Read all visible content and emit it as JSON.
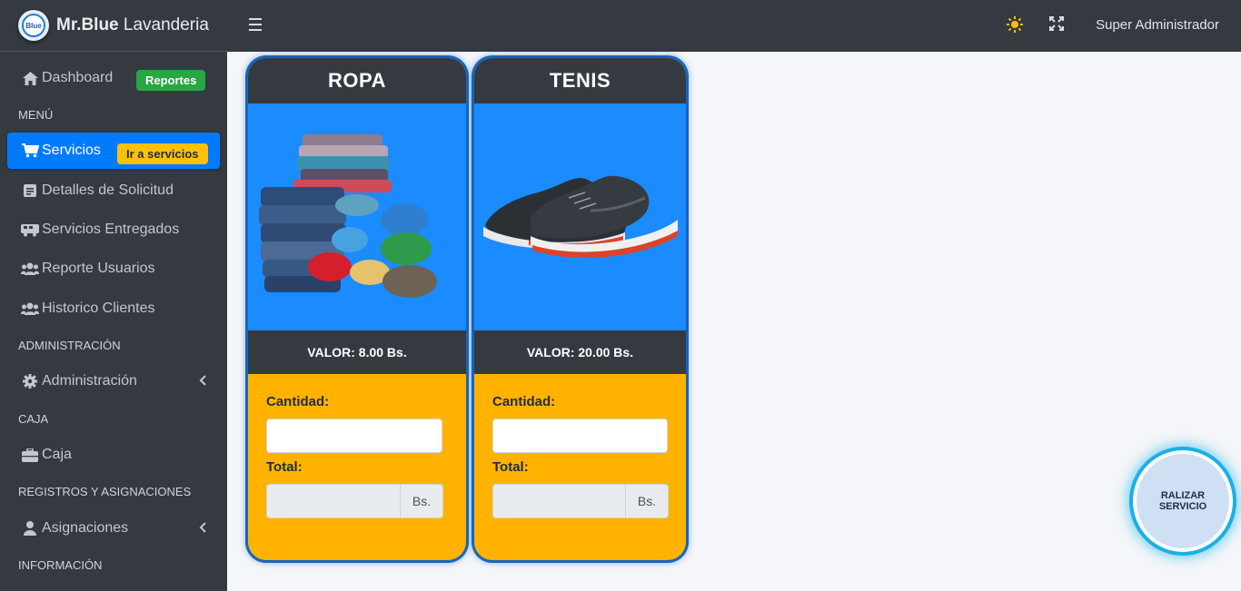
{
  "brand": {
    "name_bold": "Mr.Blue",
    "name_rest": "Lavanderia",
    "logo_text": "Blue"
  },
  "topbar": {
    "user": "Super Administrador"
  },
  "sidebar": {
    "dashboard": {
      "label": "Dashboard",
      "badge": "Reportes"
    },
    "header_menu": "MENÚ",
    "servicios": {
      "label": "Servicios",
      "badge": "Ir a servicios"
    },
    "detalles": "Detalles de Solicitud",
    "entregados": "Servicios Entregados",
    "reporte_usuarios": "Reporte Usuarios",
    "historico": "Historico Clientes",
    "header_admin": "ADMINISTRACIÓN",
    "administracion": "Administración",
    "header_caja": "CAJA",
    "caja": "Caja",
    "header_registros": "REGISTROS Y ASIGNACIONES",
    "asignaciones": "Asignaciones",
    "header_info": "INFORMACIÓN"
  },
  "cards": [
    {
      "title": "ROPA",
      "price": "VALOR: 8.00 Bs.",
      "qty_label": "Cantidad:",
      "total_label": "Total:",
      "currency": "Bs."
    },
    {
      "title": "TENIS",
      "price": "VALOR: 20.00 Bs.",
      "qty_label": "Cantidad:",
      "total_label": "Total:",
      "currency": "Bs."
    }
  ],
  "fab_label": "RALIZAR SERVICIO",
  "colors": {
    "sidebar": "#343a40",
    "active": "#007bff",
    "card_body": "#ffb300",
    "card_image_bg": "#1a8cff",
    "fab_glow": "#18b0e8"
  },
  "icons": [
    "home-icon",
    "cart-icon",
    "file-icon",
    "truck-icon",
    "users-icon",
    "gear-icon",
    "briefcase-icon",
    "user-icon",
    "sun-icon",
    "expand-icon",
    "hamburger-icon",
    "chevron-left-icon"
  ]
}
